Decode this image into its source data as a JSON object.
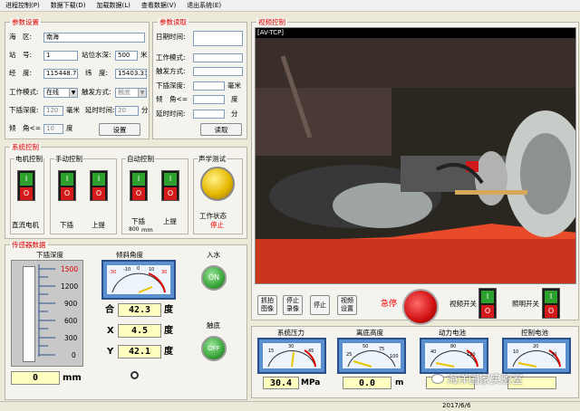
{
  "menu": [
    "进程控制(P)",
    "数据下载(D)",
    "加载数据(L)",
    "查看数据(V)",
    "退出系统(E)"
  ],
  "params": {
    "title": "参数设置",
    "sea_area_label": "海　区:",
    "sea_area": "南海",
    "station_label": "站　号:",
    "station": "1",
    "depth_label": "站位水深:",
    "depth": "500",
    "depth_unit": "米",
    "lon_label": "经　度:",
    "lon": "115448.76",
    "lat_label": "纬　度:",
    "lat": "15403.335",
    "mode_label": "工作模式:",
    "mode": "在线",
    "trigger_label": "触发方式:",
    "trigger": "触底",
    "insert_depth_label": "下插深度:",
    "insert_depth": "120",
    "insert_unit": "毫米",
    "delay_label": "延时时间:",
    "delay": "20",
    "delay_unit": "分",
    "tilt_label": "倾　角<=",
    "tilt": "10",
    "tilt_unit": "度",
    "set_button": "设置"
  },
  "read": {
    "title": "参数读取",
    "date_label": "日期时间:",
    "mode_label": "工作模式:",
    "trigger_label": "触发方式:",
    "depth_label": "下插深度:",
    "depth_unit": "毫米",
    "tilt_label": "倾　角<=",
    "tilt_unit": "度",
    "delay_label": "延时时间:",
    "delay_unit": "分",
    "read_button": "读取"
  },
  "video": {
    "title": "视频控制",
    "header": "[AV-TCP]"
  },
  "video_buttons": {
    "capture": "抓拍\n图像",
    "stop_record": "停止\n录像",
    "stop": "停止",
    "settings": "视频\n设置",
    "estop": "急停",
    "video_switch": "视频开关",
    "light_switch": "照明开关"
  },
  "system": {
    "title": "系统控制",
    "motor": {
      "title": "电机控制",
      "caption": "直流电机"
    },
    "manual": {
      "title": "手动控制",
      "down": "下插",
      "up": "上提"
    },
    "auto": {
      "title": "自动控制",
      "down": "下插",
      "up": "上提",
      "value": "800",
      "unit": "mm"
    },
    "acoustic": {
      "title": "声学测试",
      "caption": "工作状态",
      "status": "停止"
    },
    "switch_on": "I",
    "switch_off": "O"
  },
  "sensor": {
    "title": "传感器数据",
    "depth_title": "下插深度",
    "depth_ticks": [
      "1500",
      "1200",
      "900",
      "600",
      "300",
      "0"
    ],
    "depth_value": "0",
    "depth_unit": "mm",
    "tilt_title": "倾斜角度",
    "tilt_ticks": [
      "-30",
      "-20",
      "-10",
      "0",
      "10",
      "20",
      "30"
    ],
    "combined_label": "合",
    "combined": "42.3",
    "x_label": "X",
    "x": "4.5",
    "y_label": "Y",
    "y": "42.1",
    "deg": "度",
    "water_title": "入水",
    "water_state": "ON",
    "bottom_title": "触底",
    "bottom_state": "OFF"
  },
  "gauges": [
    {
      "title": "系统压力",
      "value": "30.4",
      "unit": "MPa",
      "ticks": [
        "15",
        "30",
        "45"
      ]
    },
    {
      "title": "离底高度",
      "value": "0.0",
      "unit": "m",
      "ticks": [
        "25",
        "50",
        "75",
        "100"
      ]
    },
    {
      "title": "动力电池",
      "value": "",
      "unit": "",
      "ticks": [
        "40",
        "80",
        "120"
      ]
    },
    {
      "title": "控制电池",
      "value": "",
      "unit": "",
      "ticks": [
        "10",
        "20",
        "30"
      ]
    }
  ],
  "watermark": "海洋国家实验室",
  "status_date": "2017/6/6",
  "colors": {
    "group_title": "#dd0000",
    "gauge_bg": "#5a8fd0",
    "lcd_bg": "#ffffc0",
    "switch_on": "#2da12d",
    "switch_off": "#d41a1a",
    "estop": "#e01010",
    "indicator": "#3aa63a"
  }
}
